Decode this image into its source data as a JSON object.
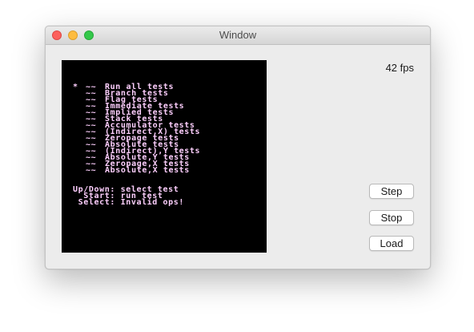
{
  "window": {
    "title": "Window"
  },
  "emulator": {
    "cursor": "*",
    "menu_marker": "~~",
    "tests": [
      "Run all tests",
      "Branch tests",
      "Flag tests",
      "Immediate tests",
      "Implied tests",
      "Stack tests",
      "Accumulator tests",
      "(Indirect,X) tests",
      "Zeropage tests",
      "Absolute tests",
      "(Indirect),Y tests",
      "Absolute,Y tests",
      "Zeropage,X tests",
      "Absolute,X tests"
    ],
    "help": [
      "Up/Down: select test",
      "  Start: run test",
      " Select: Invalid ops!"
    ],
    "text_color": "#ffd0ff",
    "background_color": "#000000"
  },
  "status": {
    "fps_label": "42 fps"
  },
  "controls": {
    "step_label": "Step",
    "stop_label": "Stop",
    "load_label": "Load"
  }
}
